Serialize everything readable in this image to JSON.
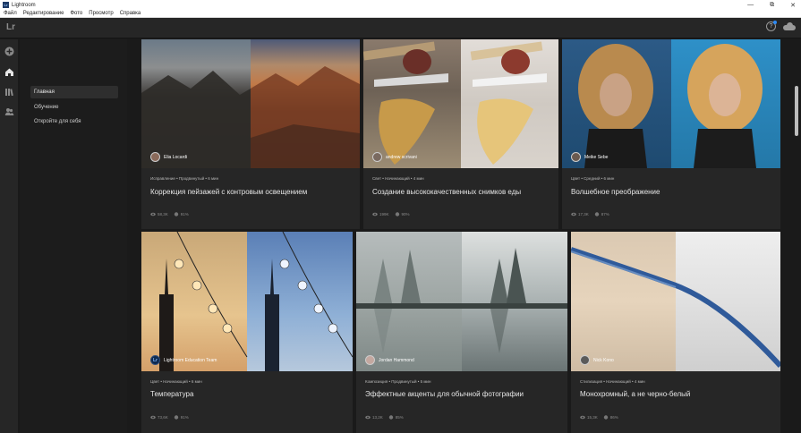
{
  "window": {
    "title": "Lightroom",
    "icon_text": "Lr"
  },
  "menu": [
    "Файл",
    "Редактирование",
    "Фото",
    "Просмотр",
    "Справка"
  ],
  "header": {
    "logo": "Lr"
  },
  "sidebar": {
    "items": [
      {
        "label": "Главная",
        "active": true
      },
      {
        "label": "Обучение",
        "active": false
      },
      {
        "label": "Откройте для себя",
        "active": false
      }
    ]
  },
  "cards": [
    {
      "author": "Elia Locardi",
      "meta": "Исправление • Продвинутый • 6 мин",
      "title": "Коррекция пейзажей с контровым освещением",
      "views": "58,3K",
      "likes": "91%"
    },
    {
      "author": "andrew scrivani",
      "meta": "Свет • Начинающий • 4 мин",
      "title": "Создание высококачественных снимков еды",
      "views": "199K",
      "likes": "90%"
    },
    {
      "author": "Meike Sebe",
      "meta": "Цвет • Средний • 6 мин",
      "title": "Волшебное преображение",
      "views": "17,3K",
      "likes": "87%"
    },
    {
      "author": "Lightroom Education Team",
      "meta": "Цвет • Начинающий • 6 мин",
      "title": "Температура",
      "views": "73,6K",
      "likes": "91%"
    },
    {
      "author": "Jordan Hammond",
      "meta": "Композиция • Продвинутый • 5 мин",
      "title": "Эффектные акценты для обычной фотографии",
      "views": "13,2K",
      "likes": "85%"
    },
    {
      "author": "Nick Kono",
      "meta": "Стилизация • Начинающий • 4 мин",
      "title": "Монохромный, а не черно-белый",
      "views": "15,3K",
      "likes": "86%"
    }
  ]
}
